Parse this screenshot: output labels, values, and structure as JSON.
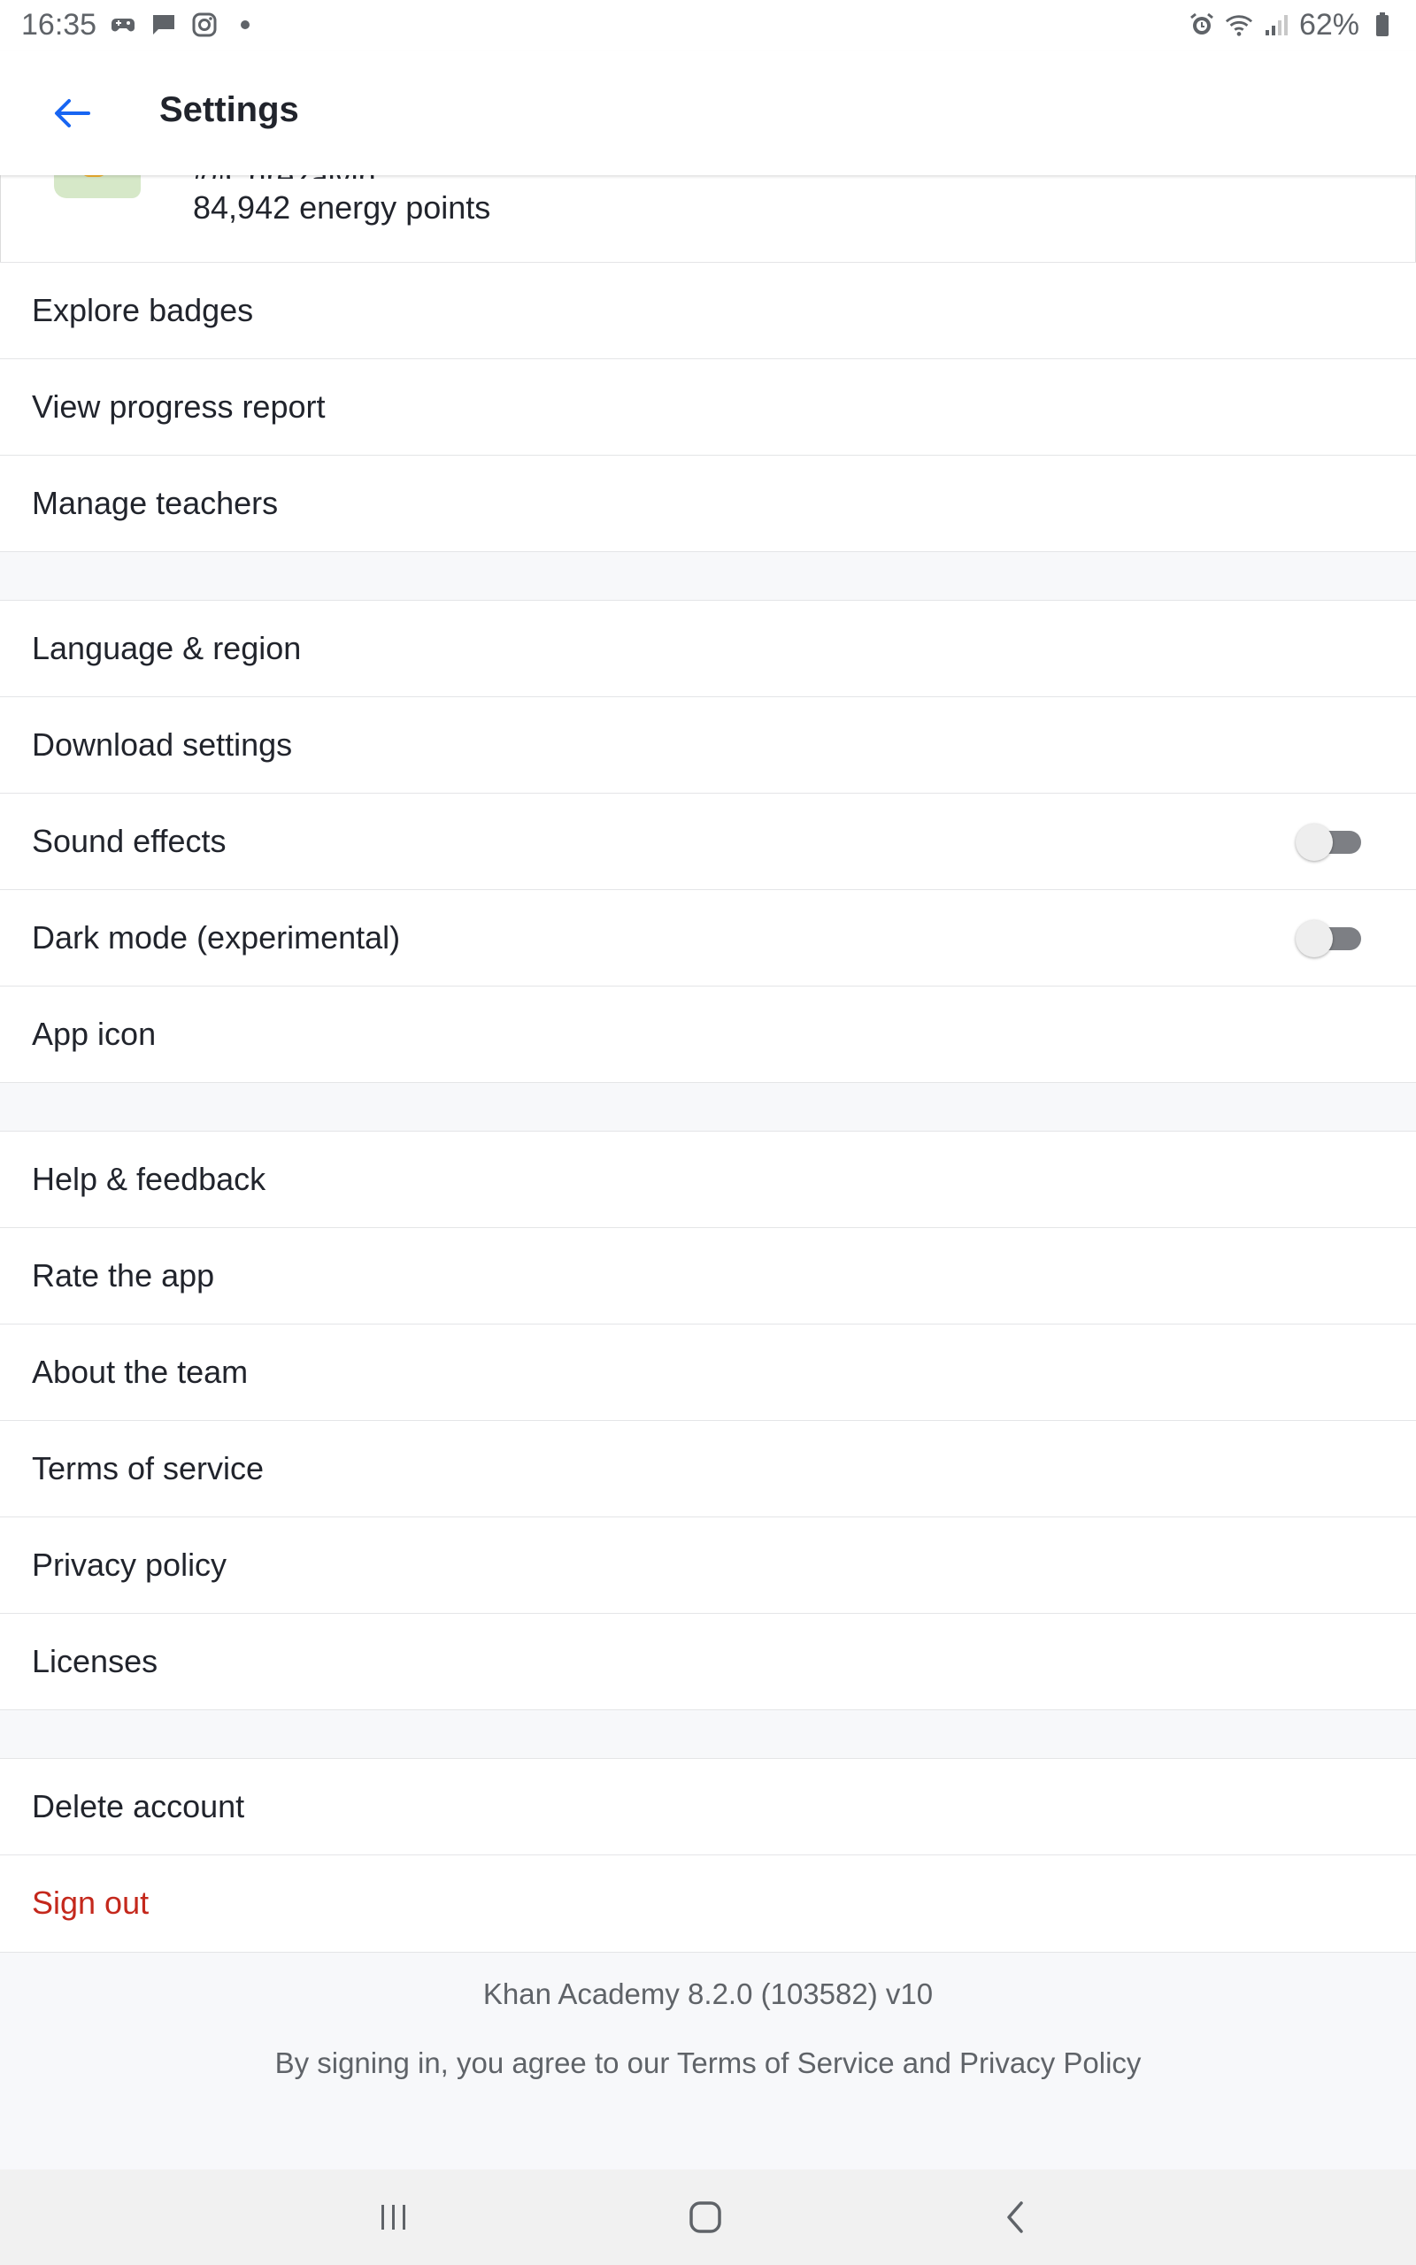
{
  "status_bar": {
    "time": "16:35",
    "battery": "62%",
    "left_icons": [
      "game-controller-icon",
      "message-icon",
      "instagram-icon",
      "dot-icon"
    ],
    "right_icons": [
      "alarm-icon",
      "wifi-icon",
      "signal-icon",
      "battery-icon"
    ]
  },
  "header": {
    "title": "Settings"
  },
  "profile": {
    "username": "@Chrezalvin",
    "energy_points": "84,942 energy points"
  },
  "groups": [
    {
      "items": [
        {
          "label": "Explore badges"
        },
        {
          "label": "View progress report"
        },
        {
          "label": "Manage teachers"
        }
      ]
    },
    {
      "items": [
        {
          "label": "Language & region"
        },
        {
          "label": "Download settings"
        },
        {
          "label": "Sound effects",
          "toggle": false
        },
        {
          "label": "Dark mode (experimental)",
          "toggle": false
        },
        {
          "label": "App icon"
        }
      ]
    },
    {
      "items": [
        {
          "label": "Help & feedback"
        },
        {
          "label": "Rate the app"
        },
        {
          "label": "About the team"
        },
        {
          "label": "Terms of service"
        },
        {
          "label": "Privacy policy"
        },
        {
          "label": "Licenses"
        }
      ]
    },
    {
      "items": [
        {
          "label": "Delete account"
        },
        {
          "label": "Sign out",
          "danger": true
        }
      ]
    }
  ],
  "footer": {
    "version": "Khan Academy 8.2.0 (103582) v10",
    "agreement": "By signing in, you agree to our Terms of Service and Privacy Policy"
  },
  "colors": {
    "accent": "#1865f2",
    "danger": "#c4281c",
    "text": "#21242c",
    "muted": "#5f6368"
  }
}
